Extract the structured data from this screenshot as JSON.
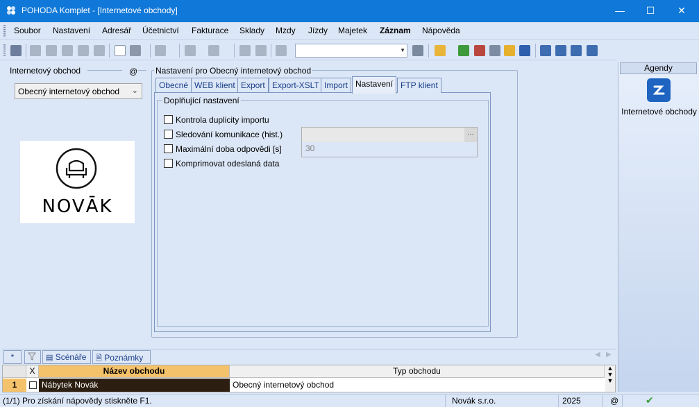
{
  "window": {
    "title": "POHODA Komplet - [Internetové obchody]"
  },
  "menu": [
    "Soubor",
    "Nastavení",
    "Adresář",
    "Účetnictví",
    "Fakturace",
    "Sklady",
    "Mzdy",
    "Jízdy",
    "Majetek",
    "Záznam",
    "Nápověda"
  ],
  "left": {
    "group_title": "Internetový obchod",
    "at_symbol": "@",
    "shop_select_value": "Obecný internetový obchod",
    "logo_text": "NOVĀK"
  },
  "settings": {
    "group_title": "Nastavení pro Obecný internetový obchod",
    "tabs": [
      "Obecné",
      "WEB klient",
      "Export",
      "Export-XSLT",
      "Import",
      "Nastavení",
      "FTP klient"
    ],
    "active_tab": "Nastavení",
    "inner_group_title": "Doplňující nastavení",
    "checkboxes": [
      {
        "label": "Kontrola duplicity importu",
        "checked": false
      },
      {
        "label": "Sledování komunikace (hist.)",
        "checked": false
      },
      {
        "label": "Maximální doba odpovědi [s]",
        "checked": false
      },
      {
        "label": "Komprimovat odeslaná data",
        "checked": false
      }
    ],
    "browse_button": "···",
    "timeout_value": "30"
  },
  "agenda": {
    "header": "Agendy",
    "item_label": "Internetové obchody"
  },
  "bottom_tabs": {
    "star": "*",
    "scenarios": "Scénáře",
    "notes": "Poznámky"
  },
  "grid": {
    "columns": [
      "X",
      "Název obchodu",
      "Typ obchodu"
    ],
    "rows": [
      {
        "num": "1",
        "name": "Nábytek Novák",
        "type": "Obecný internetový obchod"
      }
    ]
  },
  "status": {
    "hint": "(1/1) Pro získání nápovědy stiskněte F1.",
    "company": "Novák s.r.o.",
    "year": "2025",
    "at": "@"
  },
  "colors": {
    "titlebar": "#1078d8",
    "selected_header": "#f4c26a",
    "selected_row": "#2c1e10",
    "accent": "#1e64c0"
  }
}
